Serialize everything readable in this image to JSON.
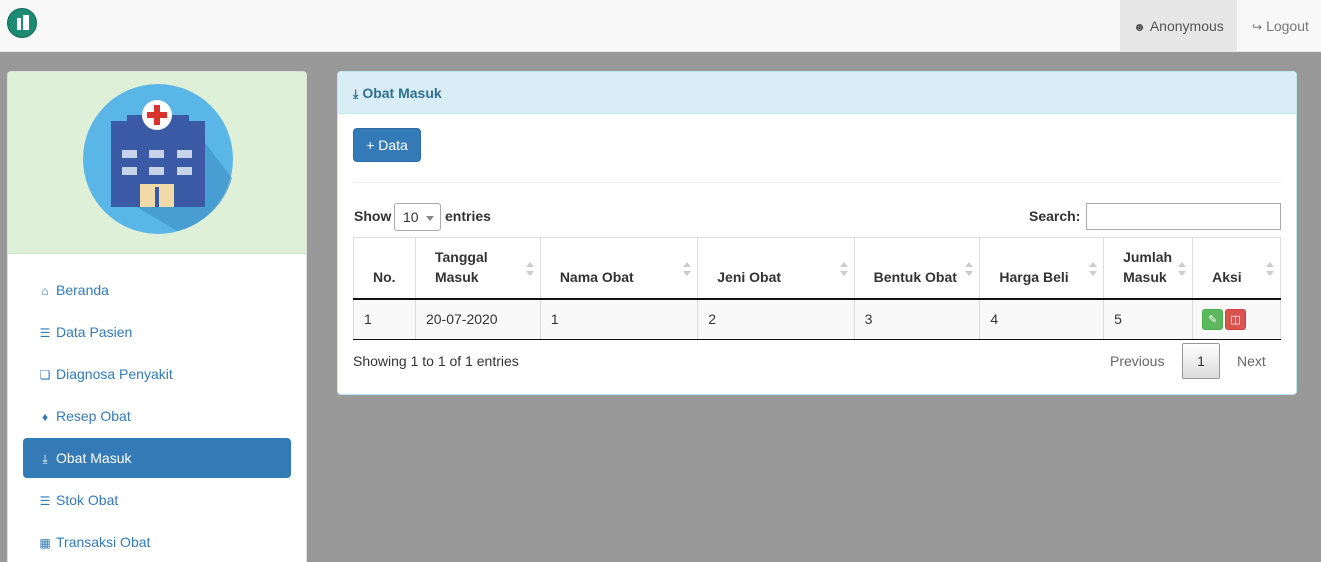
{
  "navbar": {
    "brand_icon": "pharmacy-logo-icon",
    "user_label": "Anonymous",
    "user_icon": "user-icon",
    "logout_label": "Logout",
    "logout_icon": "sign-out-icon"
  },
  "sidebar": {
    "logo_icon": "hospital-building-icon",
    "items": [
      {
        "label": "Beranda",
        "icon": "home-icon",
        "active": false
      },
      {
        "label": "Data Pasien",
        "icon": "database-icon",
        "active": false
      },
      {
        "label": "Diagnosa Penyakit",
        "icon": "copy-icon",
        "active": false
      },
      {
        "label": "Resep Obat",
        "icon": "tags-icon",
        "active": false
      },
      {
        "label": "Obat Masuk",
        "icon": "download-icon",
        "active": true
      },
      {
        "label": "Stok Obat",
        "icon": "list-icon",
        "active": false
      },
      {
        "label": "Transaksi Obat",
        "icon": "table-icon",
        "active": false
      }
    ]
  },
  "panel": {
    "title": "Obat Masuk",
    "title_icon": "download-icon",
    "add_button": "+ Data",
    "show_label": "Show",
    "entries_label": "entries",
    "page_length": "10",
    "search_label": "Search:",
    "search_value": "",
    "columns": [
      {
        "label": "No."
      },
      {
        "label": "Tanggal Masuk"
      },
      {
        "label": "Nama Obat"
      },
      {
        "label": "Jeni Obat"
      },
      {
        "label": "Bentuk Obat"
      },
      {
        "label": "Harga Beli"
      },
      {
        "label": "Jumlah Masuk"
      },
      {
        "label": "Aksi"
      }
    ],
    "rows": [
      {
        "no": "1",
        "tanggal": "20-07-2020",
        "nama": "1",
        "jenis": "2",
        "bentuk": "3",
        "harga": "4",
        "jumlah": "5"
      }
    ],
    "info": "Showing 1 to 1 of 1 entries",
    "pagination": {
      "previous": "Previous",
      "current": "1",
      "next": "Next"
    }
  },
  "colors": {
    "primary": "#337ab7",
    "panel_heading_bg": "#d9edf7",
    "panel_heading_text": "#31708f",
    "sidebar_top_bg": "#dff0d8",
    "edit": "#5cb85c",
    "delete": "#d9534f"
  }
}
